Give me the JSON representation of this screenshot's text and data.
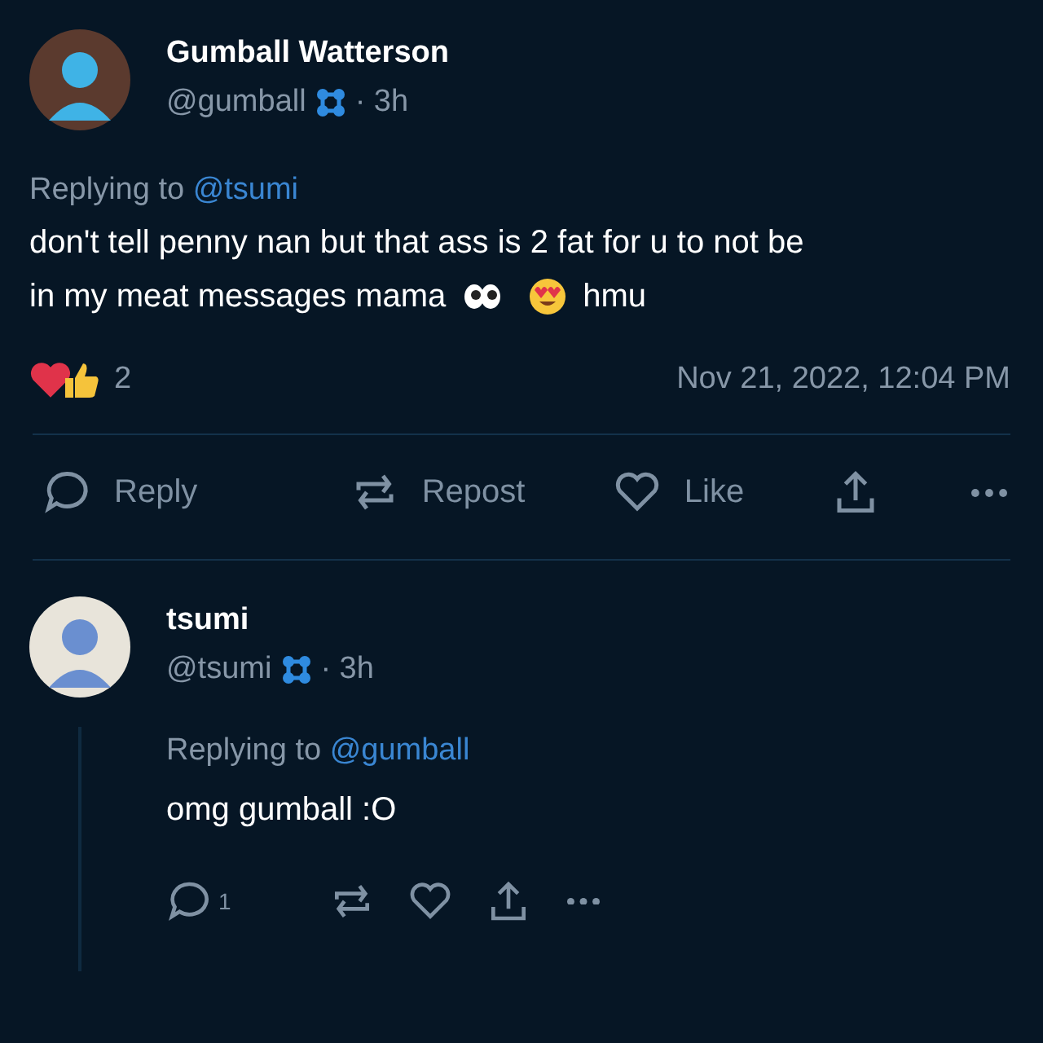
{
  "post": {
    "name": "Gumball Watterson",
    "handle": "@gumball",
    "time": "· 3h",
    "replying_prefix": "Replying to",
    "replying_to": "@tsumi",
    "text_lines": [
      "don't tell penny nan but that ass is 2 fat for u to not be",
      "in my meat messages mama"
    ],
    "trailing_text": "hmu",
    "reaction_count": "2",
    "timestamp": "Nov 21, 2022, 12:04 PM",
    "actions": [
      {
        "kind": "reply",
        "label": "Reply"
      },
      {
        "kind": "repost",
        "label": "Repost"
      },
      {
        "kind": "like",
        "label": "Like"
      },
      {
        "kind": "share"
      },
      {
        "kind": "more"
      }
    ]
  },
  "reply": {
    "name": "tsumi",
    "handle": "@tsumi",
    "time": "· 3h",
    "replying_prefix": "Replying to",
    "replying_to": "@gumball",
    "text": "omg gumball :O",
    "actions": [
      {
        "kind": "reply",
        "count": "1"
      },
      {
        "kind": "repost"
      },
      {
        "kind": "like"
      },
      {
        "kind": "share"
      },
      {
        "kind": "more"
      }
    ]
  }
}
